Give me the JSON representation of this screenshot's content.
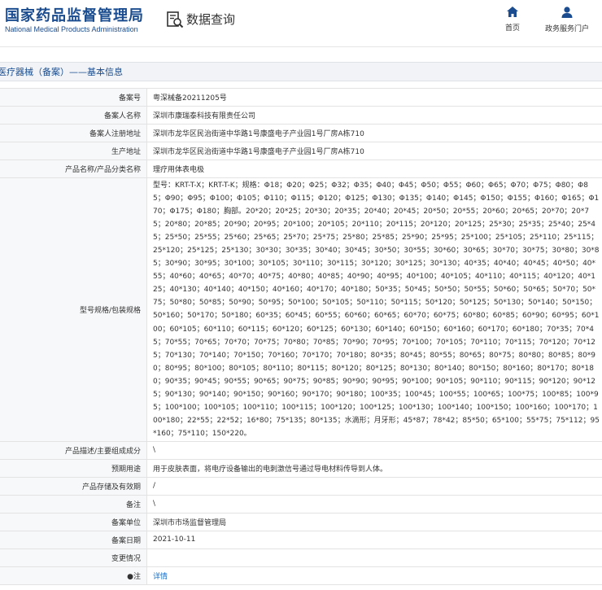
{
  "header": {
    "logo_cn": "国家药品监督管理局",
    "logo_en": "National Medical Products Administration",
    "page_title": "数据查询",
    "nav": [
      {
        "label": "首页",
        "icon": "home-icon"
      },
      {
        "label": "政务服务门户",
        "icon": "user-icon"
      }
    ]
  },
  "section": {
    "title": "医疗器械（备案）——基本信息"
  },
  "rows": [
    {
      "label": "备案号",
      "value": "粤深械备20211205号"
    },
    {
      "label": "备案人名称",
      "value": "深圳市康瑞泰科技有限责任公司"
    },
    {
      "label": "备案人注册地址",
      "value": "深圳市龙华区民治街道中华路1号康盛电子产业园1号厂房A栋710"
    },
    {
      "label": "生产地址",
      "value": "深圳市龙华区民治街道中华路1号康盛电子产业园1号厂房A栋710"
    },
    {
      "label": "产品名称/产品分类名称",
      "value": "理疗用体表电极"
    },
    {
      "label": "型号规格/包装规格",
      "value": "型号：KRT-T-X；KRT-T-K；规格：Φ18；Φ20；Φ25；Φ32；Φ35；Φ40；Φ45；Φ50；Φ55；Φ60；Φ65；Φ70；Φ75；Φ80；Φ85；Φ90；Φ95；Φ100；Φ105；Φ110；Φ115；Φ120；Φ125；Φ130；Φ135；Φ140；Φ145；Φ150；Φ155；Φ160；Φ165；Φ170；Φ175；Φ180；胸部。20*20；20*25；20*30；20*35；20*40；20*45；20*50；20*55；20*60；20*65；20*70；20*75；20*80；20*85；20*90；20*95；20*100；20*105；20*110；20*115；20*120；20*125；25*30；25*35；25*40；25*45；25*50；25*55；25*60；25*65；25*70；25*75；25*80；25*85；25*90；25*95；25*100；25*105；25*110；25*115；25*120；25*125；25*130；30*30；30*35；30*40；30*45；30*50；30*55；30*60；30*65；30*70；30*75；30*80；30*85；30*90；30*95；30*100；30*105；30*110；30*115；30*120；30*125；30*130；40*35；40*40；40*45；40*50；40*55；40*60；40*65；40*70；40*75；40*80；40*85；40*90；40*95；40*100；40*105；40*110；40*115；40*120；40*125；40*130；40*140；40*150；40*160；40*170；40*180；50*35；50*45；50*50；50*55；50*60；50*65；50*70；50*75；50*80；50*85；50*90；50*95；50*100；50*105；50*110；50*115；50*120；50*125；50*130；50*140；50*150；50*160；50*170；50*180；60*35；60*45；60*55；60*60；60*65；60*70；60*75；60*80；60*85；60*90；60*95；60*100；60*105；60*110；60*115；60*120；60*125；60*130；60*140；60*150；60*160；60*170；60*180；70*35；70*45；70*55；70*65；70*70；70*75；70*80；70*85；70*90；70*95；70*100；70*105；70*110；70*115；70*120；70*125；70*130；70*140；70*150；70*160；70*170；70*180；80*35；80*45；80*55；80*65；80*75；80*80；80*85；80*90；80*95；80*100；80*105；80*110；80*115；80*120；80*125；80*130；80*140；80*150；80*160；80*170；80*180；90*35；90*45；90*55；90*65；90*75；90*85；90*90；90*95；90*100；90*105；90*110；90*115；90*120；90*125；90*130；90*140；90*150；90*160；90*170；90*180；100*35；100*45；100*55；100*65；100*75；100*85；100*95；100*100；100*105；100*110；100*115；100*120；100*125；100*130；100*140；100*150；100*160；100*170；100*180；22*55；22*52；16*80；75*135；80*135；水滴形；月牙形；45*87；78*42；85*50；65*100；55*75；75*112；95*160；75*110；150*220。"
    },
    {
      "label": "产品描述/主要组成成分",
      "value": "\\"
    },
    {
      "label": "预期用途",
      "value": "用于皮肤表面，将电疗设备输出的电刺激信号通过导电材料传导到人体。"
    },
    {
      "label": "产品存储及有效期",
      "value": "/"
    },
    {
      "label": "备注",
      "value": "\\"
    },
    {
      "label": "备案单位",
      "value": "深圳市市场监督管理局"
    },
    {
      "label": "备案日期",
      "value": "2021-10-11"
    },
    {
      "label": "变更情况",
      "value": ""
    }
  ],
  "note_row": {
    "label": "注",
    "value": "详情"
  }
}
